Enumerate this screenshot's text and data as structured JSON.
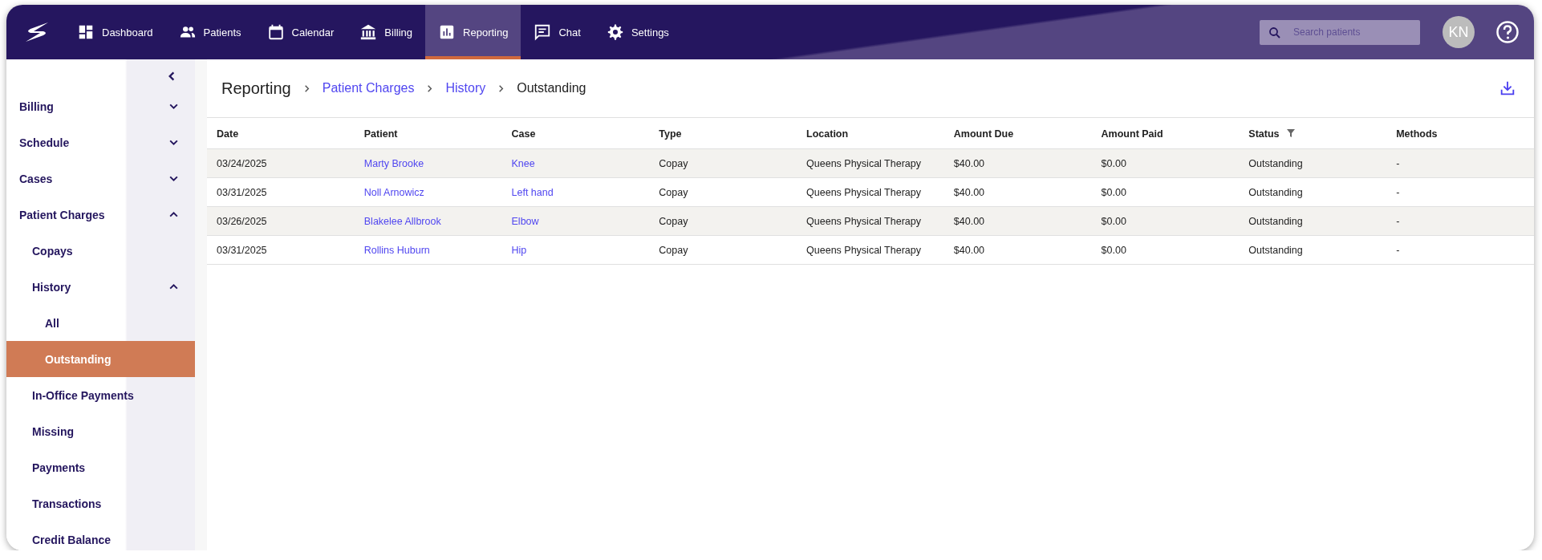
{
  "nav": {
    "tabs": [
      {
        "label": "Dashboard",
        "kind": "dashboard",
        "selected": false
      },
      {
        "label": "Patients",
        "kind": "people",
        "selected": false
      },
      {
        "label": "Calendar",
        "kind": "calendar",
        "selected": false
      },
      {
        "label": "Billing",
        "kind": "bank",
        "selected": false
      },
      {
        "label": "Reporting",
        "kind": "chart",
        "selected": true
      },
      {
        "label": "Chat",
        "kind": "chat",
        "selected": false
      },
      {
        "label": "Settings",
        "kind": "gear",
        "selected": false
      }
    ],
    "search": {
      "placeholder": "Search patients"
    },
    "avatar": "KN"
  },
  "sidebar": {
    "items": [
      {
        "label": "Billing",
        "expanded": false,
        "selected": false
      },
      {
        "label": "Schedule",
        "expanded": false,
        "selected": false
      },
      {
        "label": "Cases",
        "expanded": false,
        "selected": false
      },
      {
        "label": "Patient Charges",
        "expanded": true,
        "selected": false,
        "children": [
          {
            "label": "Copays",
            "selected": false
          },
          {
            "label": "History",
            "expanded": true,
            "selected": false,
            "children": [
              {
                "label": "All",
                "selected": false
              },
              {
                "label": "Outstanding",
                "selected": true
              }
            ]
          },
          {
            "label": "In-Office Payments",
            "selected": false
          },
          {
            "label": "Missing",
            "selected": false
          },
          {
            "label": "Payments",
            "selected": false
          },
          {
            "label": "Transactions",
            "selected": false
          },
          {
            "label": "Credit Balance",
            "selected": false
          }
        ]
      }
    ]
  },
  "breadcrumb": [
    {
      "label": "Reporting",
      "kind": "title"
    },
    {
      "label": "Patient Charges",
      "kind": "link"
    },
    {
      "label": "History",
      "kind": "link"
    },
    {
      "label": "Outstanding",
      "kind": "current"
    }
  ],
  "table": {
    "columns": [
      {
        "label": "Date",
        "filtered": false
      },
      {
        "label": "Patient",
        "filtered": false
      },
      {
        "label": "Case",
        "filtered": false
      },
      {
        "label": "Type",
        "filtered": false
      },
      {
        "label": "Location",
        "filtered": false
      },
      {
        "label": "Amount Due",
        "filtered": false
      },
      {
        "label": "Amount Paid",
        "filtered": false
      },
      {
        "label": "Status",
        "filtered": true
      },
      {
        "label": "Methods",
        "filtered": false
      }
    ],
    "rows": [
      [
        "03/24/2025",
        "Marty Brooke",
        "Knee",
        "Copay",
        "Queens Physical Therapy",
        "$40.00",
        "$0.00",
        "Outstanding",
        "-"
      ],
      [
        "03/31/2025",
        "Noll Arnowicz",
        "Left hand",
        "Copay",
        "Queens Physical Therapy",
        "$40.00",
        "$0.00",
        "Outstanding",
        "-"
      ],
      [
        "03/26/2025",
        "Blakelee Allbrook",
        "Elbow",
        "Copay",
        "Queens Physical Therapy",
        "$40.00",
        "$0.00",
        "Outstanding",
        "-"
      ],
      [
        "03/31/2025",
        "Rollins Huburn",
        "Hip",
        "Copay",
        "Queens Physical Therapy",
        "$40.00",
        "$0.00",
        "Outstanding",
        "-"
      ]
    ]
  }
}
